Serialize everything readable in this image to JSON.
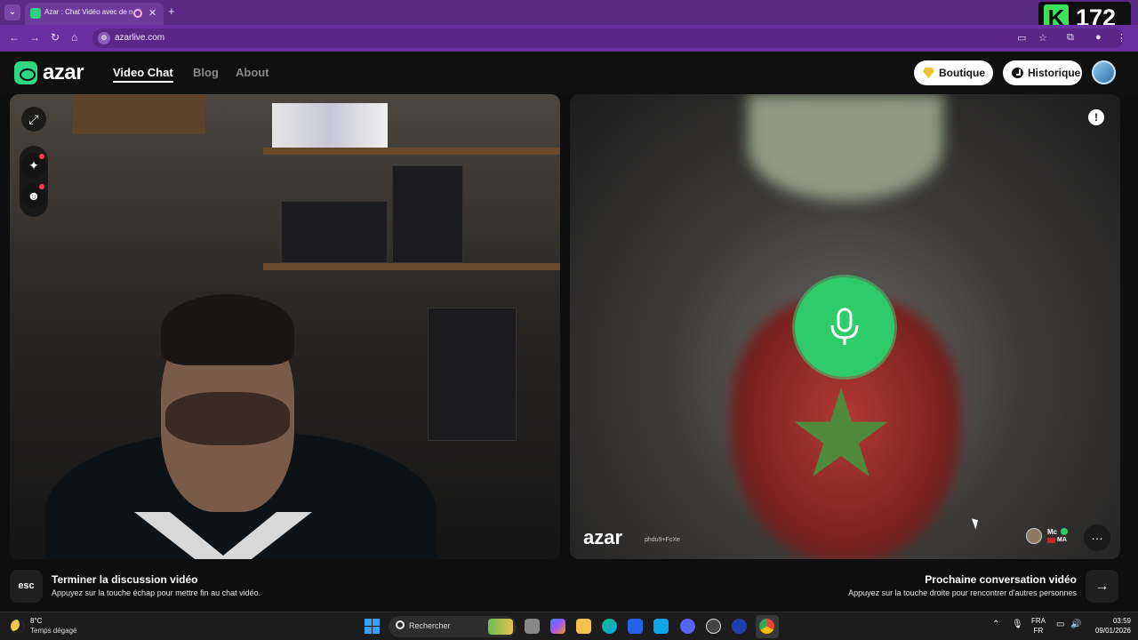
{
  "browser": {
    "tab_title": "Azar : Chat Vidéo avec de n",
    "tab_close": "✕",
    "new_tab": "+",
    "url": "azarlive.com"
  },
  "overlay": {
    "letter": "K",
    "number": "172"
  },
  "header": {
    "logo": "azar",
    "nav": [
      {
        "label": "Video Chat",
        "active": true
      },
      {
        "label": "Blog",
        "active": false
      },
      {
        "label": "About",
        "active": false
      }
    ],
    "shop_label": "Boutique",
    "history_label": "Historique"
  },
  "remote": {
    "watermark": "azar",
    "watermark_id": "phdu9+FcXe",
    "peer_name": "Mc",
    "peer_country": "MA"
  },
  "bottom": {
    "esc_key": "esc",
    "end_title": "Terminer la discussion vidéo",
    "end_sub": "Appuyez sur la touche échap pour mettre fin au chat vidéo.",
    "next_title": "Prochaine conversation vidéo",
    "next_sub": "Appuyez sur la touche droite pour rencontrer d'autres personnes"
  },
  "taskbar": {
    "temp": "8°C",
    "weather": "Temps dégagé",
    "search": "Rechercher",
    "lang_top": "FRA",
    "lang_bottom": "FR",
    "time": "03:59",
    "date": "09/01/2026"
  },
  "colors": {
    "brand_green": "#2ecb6a",
    "browser_purple": "#6a2fa0",
    "notification_red": "#ff3b57"
  },
  "icons": [
    "expand-icon",
    "sparkle-icon",
    "mask-icon",
    "microphone-icon",
    "report-icon",
    "chat-icon",
    "arrow-right-icon"
  ]
}
